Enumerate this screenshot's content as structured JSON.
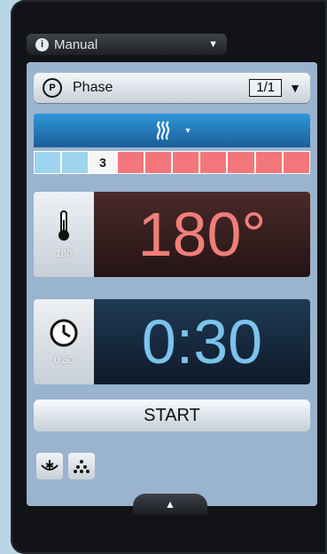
{
  "mode_bar": {
    "label": "Manual",
    "icon": "info-icon"
  },
  "phase_bar": {
    "label": "Phase",
    "page": "1/1",
    "icon": "phase-icon"
  },
  "steam_bar": {
    "icon": "steam-icon",
    "caret": "▾"
  },
  "steps": {
    "current": "3",
    "states": [
      "done",
      "done",
      "cur",
      "next",
      "next",
      "next",
      "next",
      "next",
      "next",
      "next"
    ]
  },
  "temperature": {
    "value": "180°",
    "set": "180",
    "icon": "thermometer-icon"
  },
  "time": {
    "value": "0:30",
    "set": "0:30",
    "icon": "clock-icon"
  },
  "start_button": {
    "label": "START"
  },
  "bottom_icons": [
    "fan-icon",
    "droplets-icon"
  ],
  "colors": {
    "blue": "#2a84c7",
    "temp": "#f07e79",
    "time": "#7cc3ec",
    "next": "#f3767a",
    "done": "#9fd4ef"
  }
}
